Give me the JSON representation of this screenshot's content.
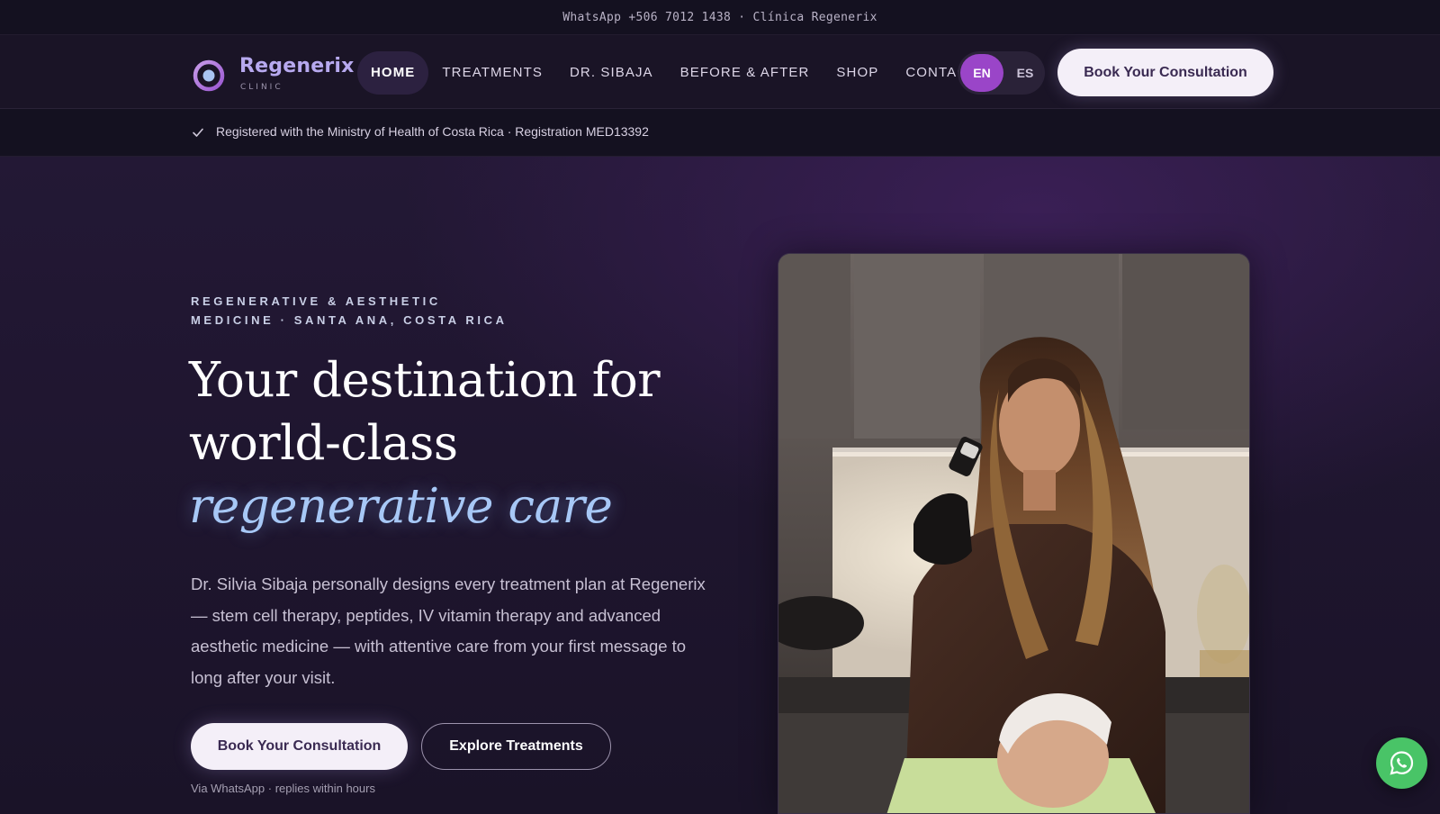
{
  "topbar": {
    "text": "WhatsApp +506 7012 1438 · Clínica Regenerix"
  },
  "brand": {
    "name": "Regenerix",
    "subtitle": "CLINIC",
    "logo_icon": "ring-dot-icon",
    "colors": {
      "primary": "#9a45c8",
      "accent": "#a7c8f6"
    }
  },
  "nav": {
    "items": [
      {
        "label": "HOME",
        "active": true
      },
      {
        "label": "TREATMENTS"
      },
      {
        "label": "DR. SIBAJA"
      },
      {
        "label": "BEFORE & AFTER"
      },
      {
        "label": "SHOP"
      },
      {
        "label": "CONTACT"
      }
    ],
    "lang": {
      "en": "EN",
      "es": "ES",
      "selected": "EN"
    },
    "cta": "Book Your Consultation"
  },
  "registration": {
    "icon": "check-icon",
    "text": "Registered with the Ministry of Health of Costa Rica · Registration MED13392"
  },
  "hero": {
    "eyebrow_line1": "REGENERATIVE & AESTHETIC",
    "eyebrow_line2": "MEDICINE · SANTA ANA, COSTA RICA",
    "headline_part1": "Your destination for world-class ",
    "headline_emphasis": "regenerative care",
    "lead": "Dr. Silvia Sibaja personally designs every treatment plan at Regenerix — stem cell therapy, peptides, IV vitamin therapy and advanced aesthetic medicine — with attentive care from your first message to long after your visit.",
    "primary_button": "Book Your Consultation",
    "secondary_button": "Explore Treatments",
    "cta_note": "Via WhatsApp · replies within hours"
  },
  "floating": {
    "whatsapp_icon": "whatsapp-icon"
  }
}
